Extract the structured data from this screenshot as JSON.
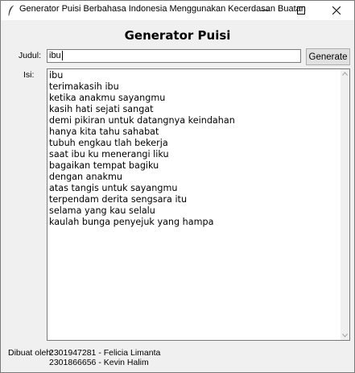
{
  "window": {
    "title": "Generator Puisi Berbahasa Indonesia Menggunakan Kecerdasan Buatan",
    "icon": "feather-icon",
    "controls": [
      "minimize-icon",
      "maximize-icon",
      "close-icon"
    ]
  },
  "header": {
    "title": "Generator Puisi"
  },
  "form": {
    "judul_label": "Judul:",
    "judul_value": "ibu",
    "generate_label": "Generate",
    "isi_label": "Isi:"
  },
  "poem": {
    "lines": [
      "ibu",
      "terimakasih ibu",
      "ketika anakmu sayangmu",
      "kasih hati sejati sangat",
      "demi pikiran untuk datangnya keindahan",
      "hanya kita tahu sahabat",
      "tubuh engkau tlah bekerja",
      "saat ibu ku menerangi liku",
      "bagaikan tempat bagiku",
      "dengan anakmu",
      "atas tangis untuk sayangmu",
      "terpendam derita sengsara itu",
      "selama yang kau selalu",
      "kaulah bunga penyejuk yang hampa"
    ]
  },
  "footer": {
    "label": "Dibuat oleh:",
    "authors": [
      "2301947281 - Felicia Limanta",
      "2301866656 - Kevin Halim"
    ]
  },
  "colors": {
    "background": "#f0f0f0",
    "titlebar": "#ffffff",
    "button": "#e1e1e1",
    "border": "#7a7a7a"
  }
}
